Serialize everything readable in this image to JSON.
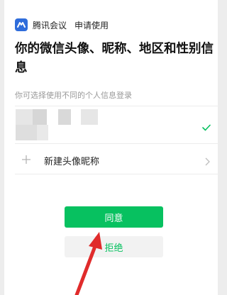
{
  "app": {
    "name": "腾讯会议",
    "action": "申请使用"
  },
  "title": "你的微信头像、昵称、地区和性别信息",
  "hint": "你可选择使用不同的个人信息登录",
  "new_profile": {
    "label": "新建头像昵称"
  },
  "buttons": {
    "agree": "同意",
    "reject": "拒绝"
  },
  "colors": {
    "accent_green": "#07c160",
    "logo_blue": "#2f6ddb",
    "annotation_red": "#e02b2b"
  },
  "icons": [
    "tencent-meeting-logo-icon",
    "checkmark-icon",
    "plus-icon",
    "chevron-right-icon",
    "annotation-arrow"
  ]
}
